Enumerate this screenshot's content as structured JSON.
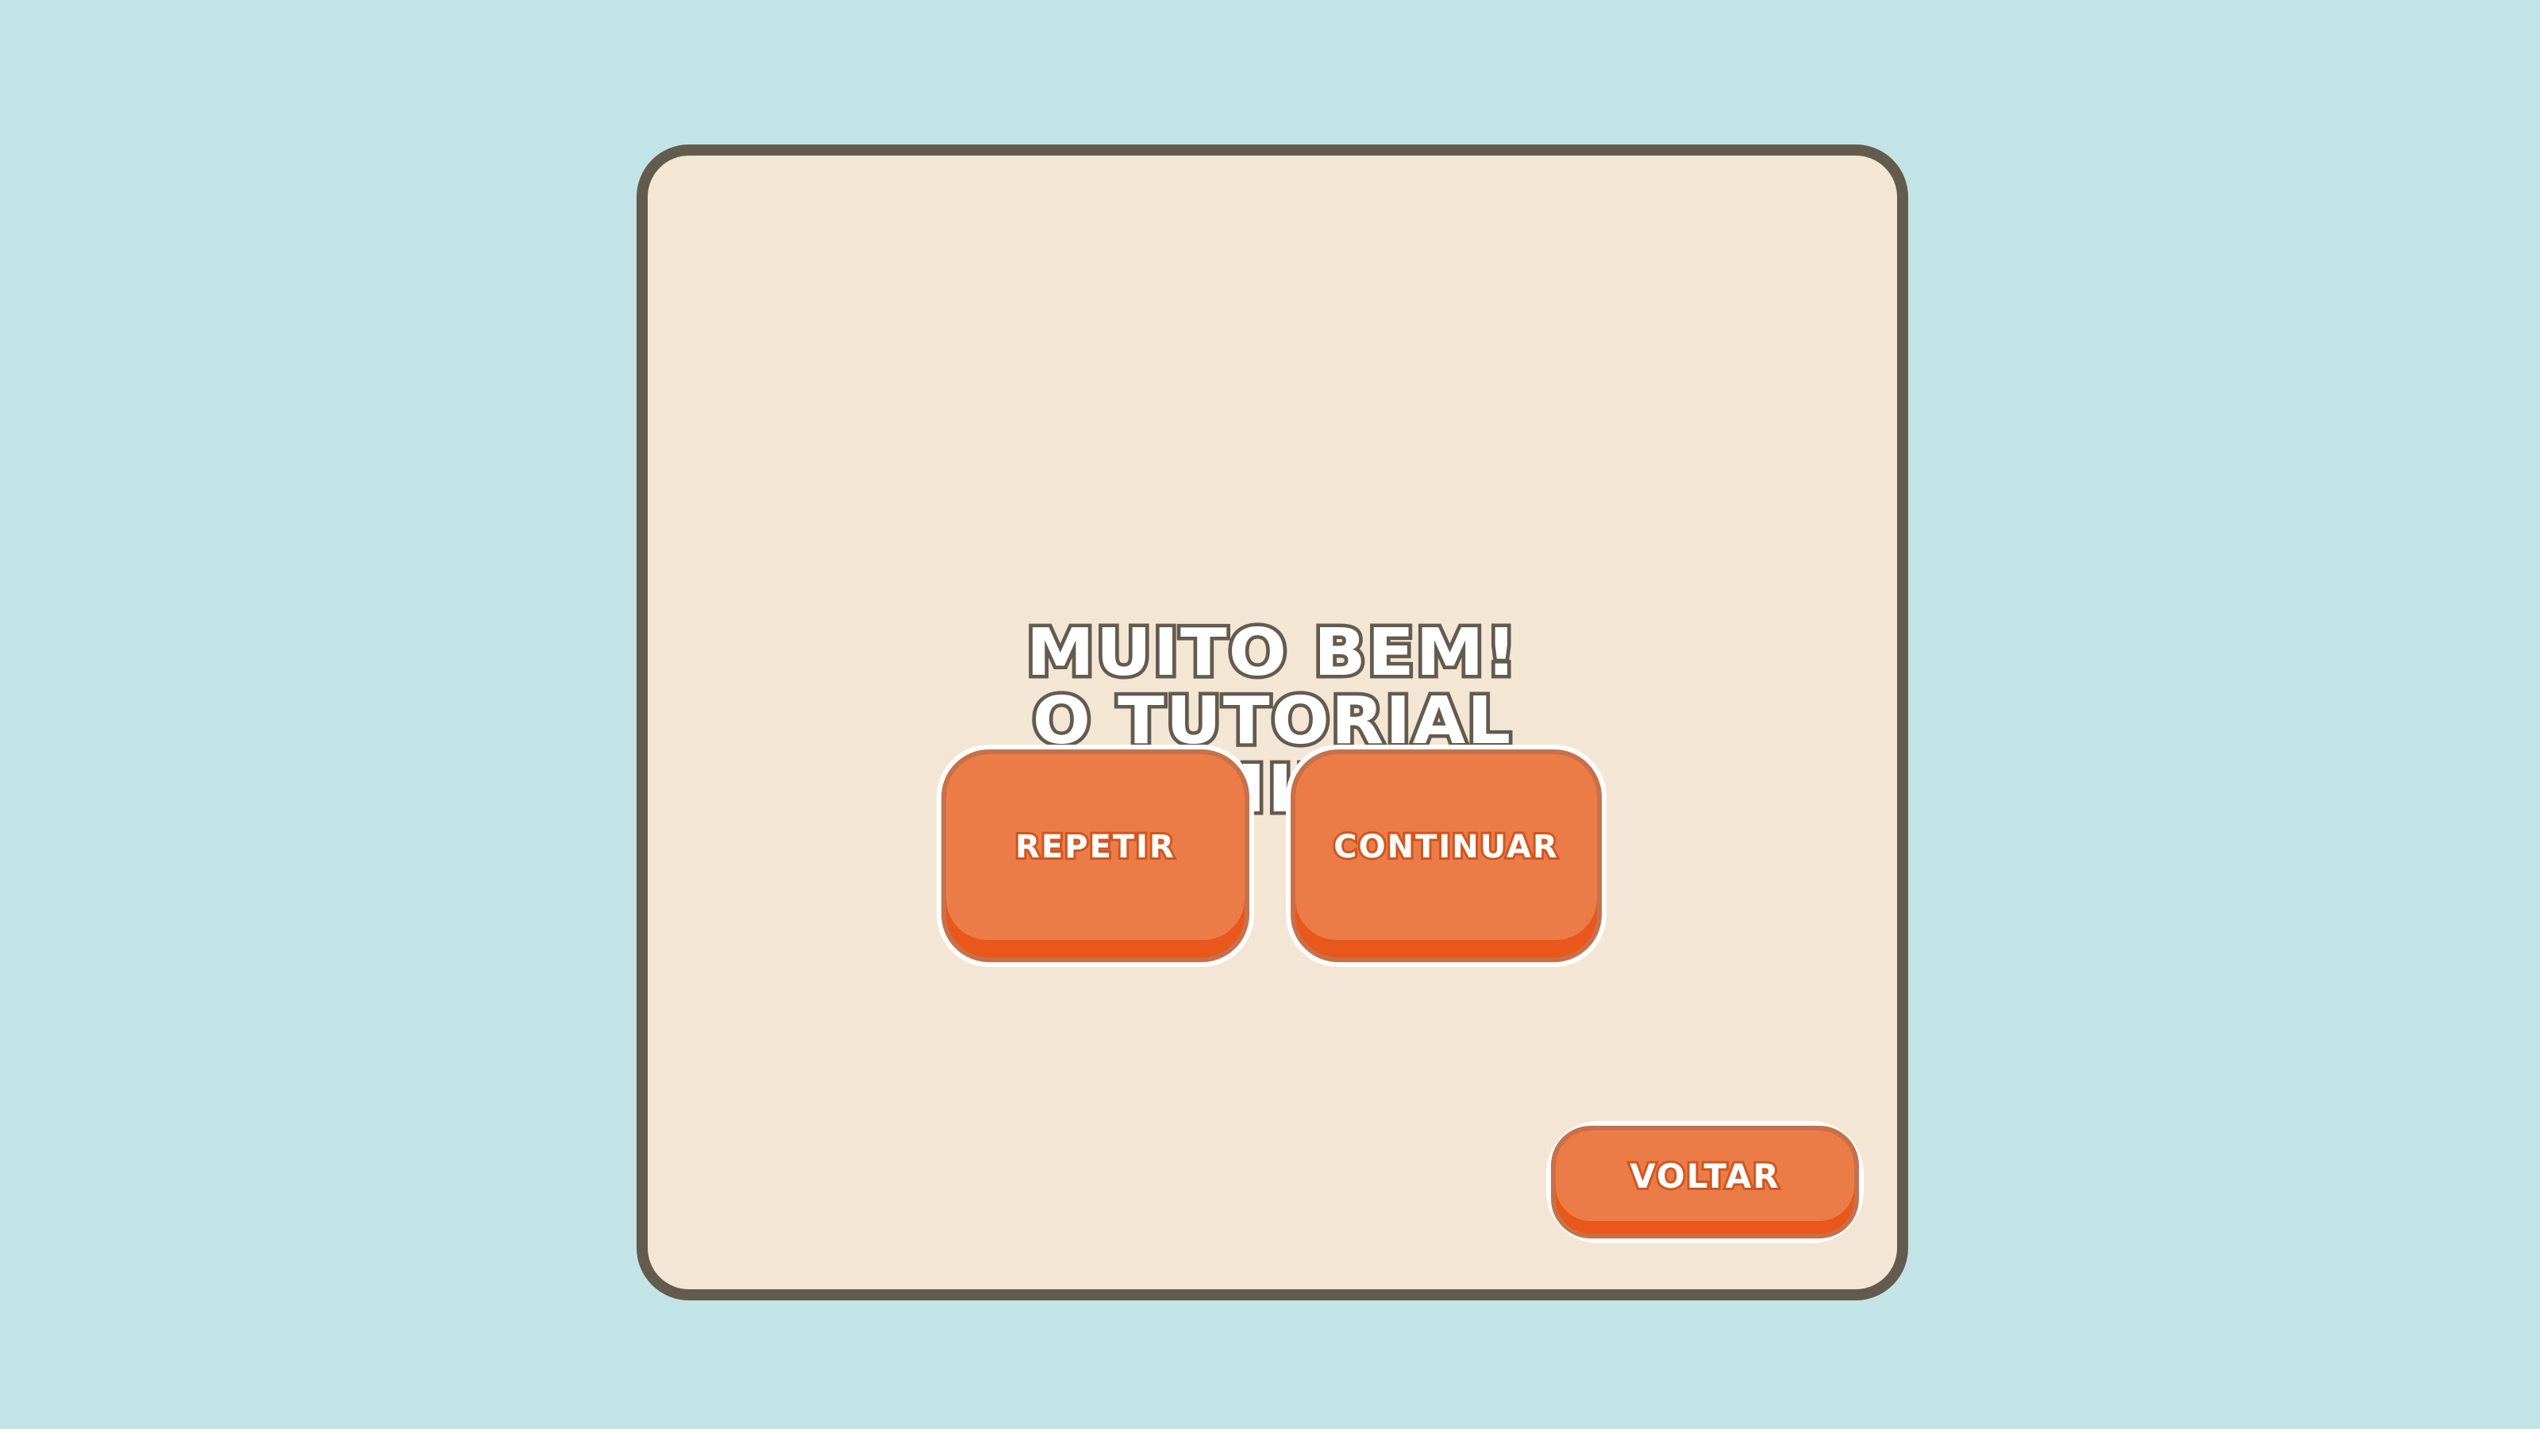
{
  "dialog": {
    "message_lines": [
      "MUITO BEM!",
      "O TUTORIAL",
      "TERMINOU."
    ]
  },
  "buttons": {
    "repeat_label": "REPETIR",
    "continue_label": "CONTINUAR",
    "back_label": "VOLTAR"
  },
  "colors": {
    "background": "#c2e4e6",
    "panel": "#f4e6d5",
    "panel_border": "#635b4e",
    "button_face": "#ec7c47",
    "button_shadow": "#e9571a"
  }
}
